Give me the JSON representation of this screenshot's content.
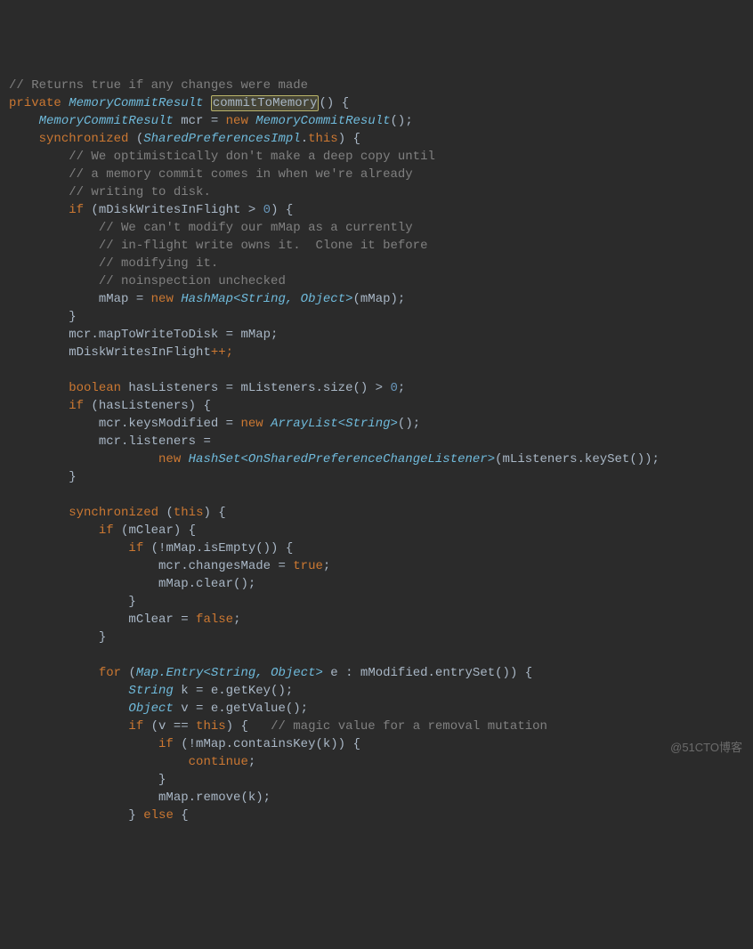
{
  "code": {
    "l1_comment": "// Returns true if any changes were made",
    "l2_private": "private",
    "l2_type": "MemoryCommitResult",
    "l2_method": "commitToMemory",
    "l2_rest": "() {",
    "l3_type": "MemoryCommitResult",
    "l3_var": " mcr = ",
    "l3_new": "new",
    "l3_ctor": " MemoryCommitResult",
    "l3_end": "();",
    "l4_sync": "synchronized",
    "l4_open": " (",
    "l4_cls": "SharedPreferencesImpl",
    "l4_dot": ".",
    "l4_this": "this",
    "l4_close": ") {",
    "l5": "// We optimistically don't make a deep copy until",
    "l6": "// a memory commit comes in when we're already",
    "l7": "// writing to disk.",
    "l8_if": "if",
    "l8_open": " (mDiskWritesInFlight > ",
    "l8_zero": "0",
    "l8_close": ") {",
    "l9": "// We can't modify our mMap as a currently",
    "l10": "// in-flight write owns it.  Clone it before",
    "l11": "// modifying it.",
    "l12": "// noinspection unchecked",
    "l13_var": "mMap = ",
    "l13_new": "new",
    "l13_type": " HashMap<String, Object>",
    "l13_end": "(mMap);",
    "l14": "}",
    "l15": "mcr.mapToWriteToDisk = mMap;",
    "l16_a": "mDiskWritesInFlight",
    "l16_b": "++;",
    "l18_bool": "boolean",
    "l18_rest": " hasListeners = mListeners.size() > ",
    "l18_zero": "0",
    "l18_semi": ";",
    "l19_if": "if",
    "l19_rest": " (hasListeners) {",
    "l20_a": "mcr.keysModified = ",
    "l20_new": "new",
    "l20_type": " ArrayList<String>",
    "l20_end": "();",
    "l21": "mcr.listeners =",
    "l22_new": "new",
    "l22_type": " HashSet<OnSharedPreferenceChangeListener>",
    "l22_end": "(mListeners.keySet());",
    "l23": "}",
    "l25_sync": "synchronized",
    "l25_rest": " (",
    "l25_this": "this",
    "l25_close": ") {",
    "l26_if": "if",
    "l26_rest": " (mClear) {",
    "l27_if": "if",
    "l27_rest": " (!mMap.isEmpty()) {",
    "l28_a": "mcr.changesMade = ",
    "l28_true": "true",
    "l28_semi": ";",
    "l29": "mMap.clear();",
    "l30": "}",
    "l31_a": "mClear = ",
    "l31_false": "false",
    "l31_semi": ";",
    "l32": "}",
    "l34_for": "for",
    "l34_open": " (",
    "l34_type": "Map.Entry<String, Object>",
    "l34_rest": " e : mModified.entrySet()) {",
    "l35_type": "String",
    "l35_rest": " k = e.getKey();",
    "l36_type": "Object",
    "l36_rest": " v = e.getValue();",
    "l37_if": "if",
    "l37_open": " (v == ",
    "l37_this": "this",
    "l37_close": ") {   ",
    "l37_comment": "// magic value for a removal mutation",
    "l38_if": "if",
    "l38_rest": " (!mMap.containsKey(k)) {",
    "l39_cont": "continue",
    "l39_semi": ";",
    "l40": "}",
    "l41": "mMap.remove(k);",
    "l42_close": "} ",
    "l42_else": "else",
    "l42_open": " {"
  },
  "watermark": "@51CTO博客"
}
